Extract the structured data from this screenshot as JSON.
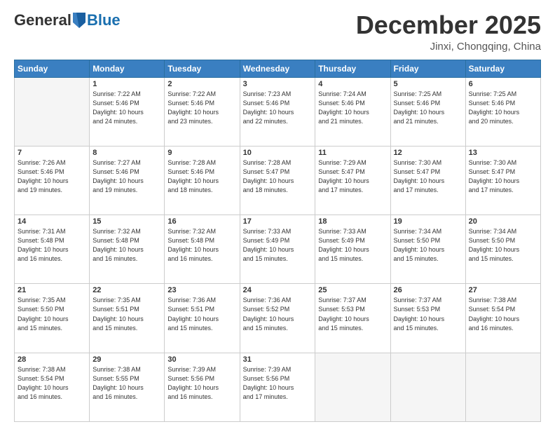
{
  "header": {
    "logo": {
      "general": "General",
      "blue": "Blue"
    },
    "title": "December 2025",
    "location": "Jinxi, Chongqing, China"
  },
  "weekdays": [
    "Sunday",
    "Monday",
    "Tuesday",
    "Wednesday",
    "Thursday",
    "Friday",
    "Saturday"
  ],
  "weeks": [
    [
      {
        "day": "",
        "info": ""
      },
      {
        "day": "1",
        "info": "Sunrise: 7:22 AM\nSunset: 5:46 PM\nDaylight: 10 hours\nand 24 minutes."
      },
      {
        "day": "2",
        "info": "Sunrise: 7:22 AM\nSunset: 5:46 PM\nDaylight: 10 hours\nand 23 minutes."
      },
      {
        "day": "3",
        "info": "Sunrise: 7:23 AM\nSunset: 5:46 PM\nDaylight: 10 hours\nand 22 minutes."
      },
      {
        "day": "4",
        "info": "Sunrise: 7:24 AM\nSunset: 5:46 PM\nDaylight: 10 hours\nand 21 minutes."
      },
      {
        "day": "5",
        "info": "Sunrise: 7:25 AM\nSunset: 5:46 PM\nDaylight: 10 hours\nand 21 minutes."
      },
      {
        "day": "6",
        "info": "Sunrise: 7:25 AM\nSunset: 5:46 PM\nDaylight: 10 hours\nand 20 minutes."
      }
    ],
    [
      {
        "day": "7",
        "info": "Sunrise: 7:26 AM\nSunset: 5:46 PM\nDaylight: 10 hours\nand 19 minutes."
      },
      {
        "day": "8",
        "info": "Sunrise: 7:27 AM\nSunset: 5:46 PM\nDaylight: 10 hours\nand 19 minutes."
      },
      {
        "day": "9",
        "info": "Sunrise: 7:28 AM\nSunset: 5:46 PM\nDaylight: 10 hours\nand 18 minutes."
      },
      {
        "day": "10",
        "info": "Sunrise: 7:28 AM\nSunset: 5:47 PM\nDaylight: 10 hours\nand 18 minutes."
      },
      {
        "day": "11",
        "info": "Sunrise: 7:29 AM\nSunset: 5:47 PM\nDaylight: 10 hours\nand 17 minutes."
      },
      {
        "day": "12",
        "info": "Sunrise: 7:30 AM\nSunset: 5:47 PM\nDaylight: 10 hours\nand 17 minutes."
      },
      {
        "day": "13",
        "info": "Sunrise: 7:30 AM\nSunset: 5:47 PM\nDaylight: 10 hours\nand 17 minutes."
      }
    ],
    [
      {
        "day": "14",
        "info": "Sunrise: 7:31 AM\nSunset: 5:48 PM\nDaylight: 10 hours\nand 16 minutes."
      },
      {
        "day": "15",
        "info": "Sunrise: 7:32 AM\nSunset: 5:48 PM\nDaylight: 10 hours\nand 16 minutes."
      },
      {
        "day": "16",
        "info": "Sunrise: 7:32 AM\nSunset: 5:48 PM\nDaylight: 10 hours\nand 16 minutes."
      },
      {
        "day": "17",
        "info": "Sunrise: 7:33 AM\nSunset: 5:49 PM\nDaylight: 10 hours\nand 15 minutes."
      },
      {
        "day": "18",
        "info": "Sunrise: 7:33 AM\nSunset: 5:49 PM\nDaylight: 10 hours\nand 15 minutes."
      },
      {
        "day": "19",
        "info": "Sunrise: 7:34 AM\nSunset: 5:50 PM\nDaylight: 10 hours\nand 15 minutes."
      },
      {
        "day": "20",
        "info": "Sunrise: 7:34 AM\nSunset: 5:50 PM\nDaylight: 10 hours\nand 15 minutes."
      }
    ],
    [
      {
        "day": "21",
        "info": "Sunrise: 7:35 AM\nSunset: 5:50 PM\nDaylight: 10 hours\nand 15 minutes."
      },
      {
        "day": "22",
        "info": "Sunrise: 7:35 AM\nSunset: 5:51 PM\nDaylight: 10 hours\nand 15 minutes."
      },
      {
        "day": "23",
        "info": "Sunrise: 7:36 AM\nSunset: 5:51 PM\nDaylight: 10 hours\nand 15 minutes."
      },
      {
        "day": "24",
        "info": "Sunrise: 7:36 AM\nSunset: 5:52 PM\nDaylight: 10 hours\nand 15 minutes."
      },
      {
        "day": "25",
        "info": "Sunrise: 7:37 AM\nSunset: 5:53 PM\nDaylight: 10 hours\nand 15 minutes."
      },
      {
        "day": "26",
        "info": "Sunrise: 7:37 AM\nSunset: 5:53 PM\nDaylight: 10 hours\nand 15 minutes."
      },
      {
        "day": "27",
        "info": "Sunrise: 7:38 AM\nSunset: 5:54 PM\nDaylight: 10 hours\nand 16 minutes."
      }
    ],
    [
      {
        "day": "28",
        "info": "Sunrise: 7:38 AM\nSunset: 5:54 PM\nDaylight: 10 hours\nand 16 minutes."
      },
      {
        "day": "29",
        "info": "Sunrise: 7:38 AM\nSunset: 5:55 PM\nDaylight: 10 hours\nand 16 minutes."
      },
      {
        "day": "30",
        "info": "Sunrise: 7:39 AM\nSunset: 5:56 PM\nDaylight: 10 hours\nand 16 minutes."
      },
      {
        "day": "31",
        "info": "Sunrise: 7:39 AM\nSunset: 5:56 PM\nDaylight: 10 hours\nand 17 minutes."
      },
      {
        "day": "",
        "info": ""
      },
      {
        "day": "",
        "info": ""
      },
      {
        "day": "",
        "info": ""
      }
    ]
  ]
}
